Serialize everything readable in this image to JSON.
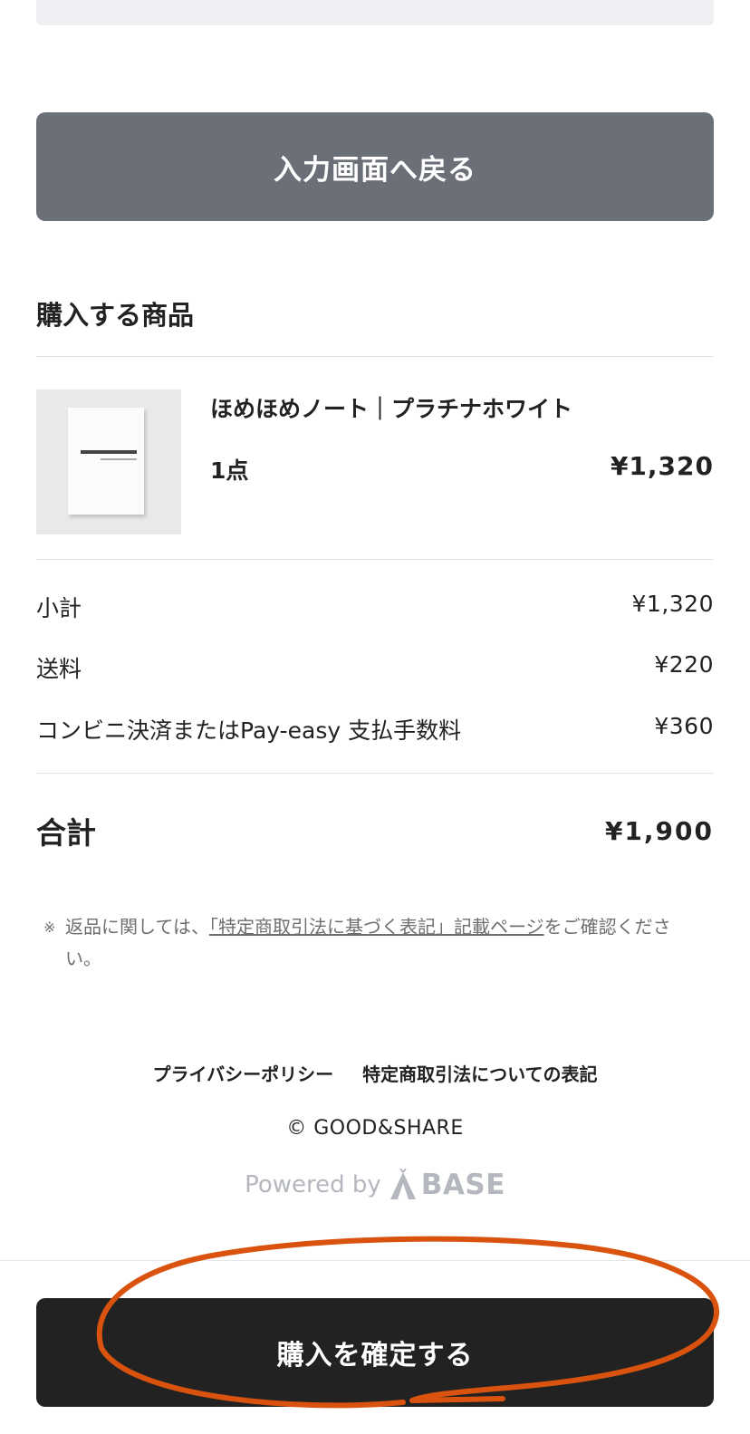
{
  "back_button": {
    "label": "入力画面へ戻る"
  },
  "section": {
    "title": "購入する商品"
  },
  "product": {
    "name": "ほめほめノート｜プラチナホワイト",
    "quantity": "1点",
    "price": "¥1,320",
    "thumbnail_icon": "notebook-image"
  },
  "summary": {
    "rows": [
      {
        "label": "小計",
        "value": "¥1,320"
      },
      {
        "label": "送料",
        "value": "¥220"
      },
      {
        "label": "コンビニ決済またはPay-easy 支払手数料",
        "value": "¥360"
      }
    ]
  },
  "total": {
    "label": "合計",
    "value": "¥1,900"
  },
  "note": {
    "mark": "※",
    "prefix": "返品に関しては、",
    "link": "「特定商取引法に基づく表記」記載ページ",
    "suffix": "をご確認ください。"
  },
  "footer": {
    "links": [
      "プライバシーポリシー",
      "特定商取引法についての表記"
    ],
    "copyright": "© GOOD&SHARE",
    "powered_by": "Powered by",
    "brand": "BASE"
  },
  "confirm_button": {
    "label": "購入を確定する"
  },
  "colors": {
    "back_button": "#6b6f77",
    "confirm_button": "#222222",
    "annotation": "#d9530f",
    "muted_text": "#6e6e6e",
    "brand": "#b4b7bd"
  }
}
